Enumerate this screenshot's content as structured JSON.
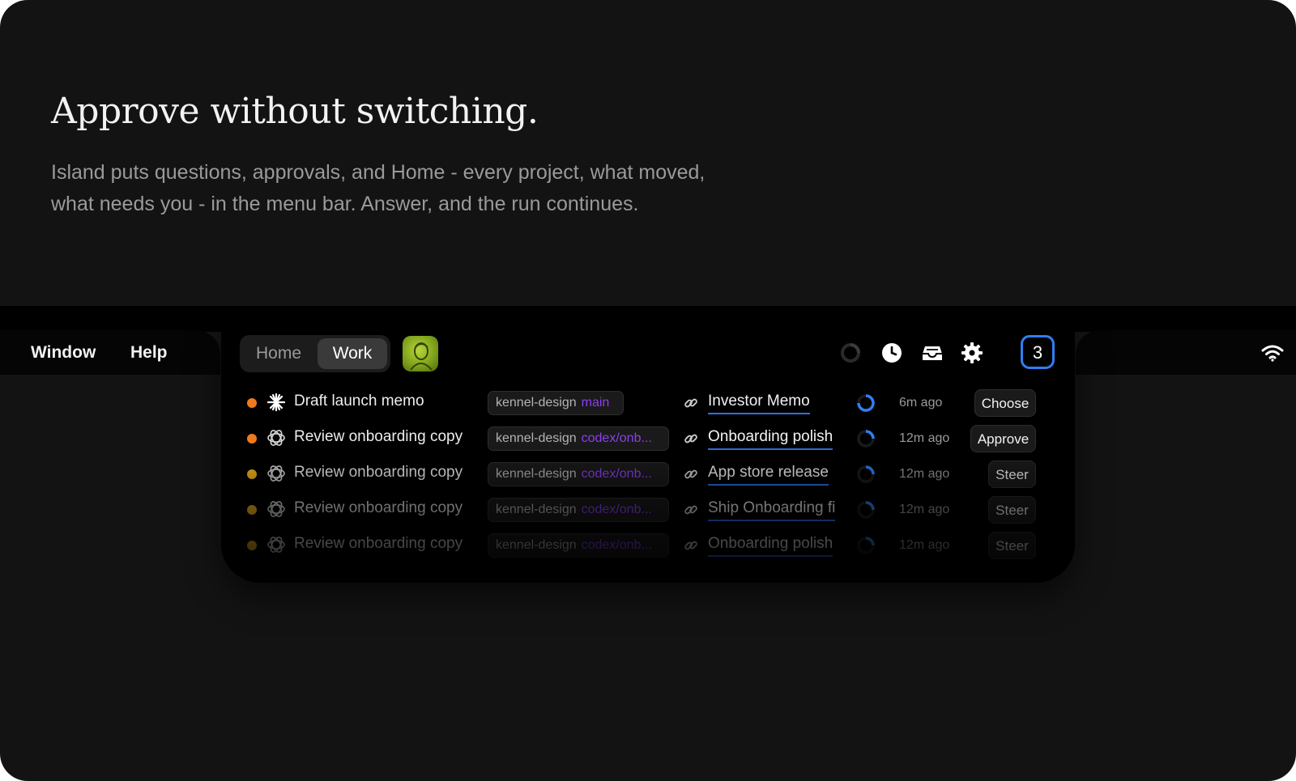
{
  "hero": {
    "title": "Approve without switching.",
    "body_line1": "Island puts questions, approvals, and Home - every project, what moved,",
    "body_line2": "what needs you - in the menu bar. Answer, and the run continues."
  },
  "menubar": {
    "items": [
      "Window",
      "Help"
    ]
  },
  "island": {
    "tabs": [
      {
        "label": "Home",
        "selected": false
      },
      {
        "label": "Work",
        "selected": true
      }
    ],
    "badge_count": "3",
    "accent": "#2f7ff0",
    "rows": [
      {
        "status_color": "#f07a1a",
        "agent_icon": "sparkle-icon",
        "task": "Draft launch memo",
        "repo": "kennel-design",
        "branch": "main",
        "link": "Investor Memo",
        "time": "6m ago",
        "action": "Choose"
      },
      {
        "status_color": "#f07a1a",
        "agent_icon": "openai-knot-icon",
        "task": "Review onboarding copy",
        "repo": "kennel-design",
        "branch": "codex/onb...",
        "link": "Onboarding polish",
        "time": "12m ago",
        "action": "Approve"
      },
      {
        "status_color": "#f4b41a",
        "agent_icon": "openai-knot-icon",
        "task": "Review onboarding copy",
        "repo": "kennel-design",
        "branch": "codex/onb...",
        "link": "App store release",
        "time": "12m ago",
        "action": "Steer"
      },
      {
        "status_color": "#f4b41a",
        "agent_icon": "openai-knot-icon",
        "task": "Review onboarding copy",
        "repo": "kennel-design",
        "branch": "codex/onb...",
        "link": "Ship Onboarding fi",
        "time": "12m ago",
        "action": "Steer"
      },
      {
        "status_color": "#f4b41a",
        "agent_icon": "openai-knot-icon",
        "task": "Review onboarding copy",
        "repo": "kennel-design",
        "branch": "codex/onb...",
        "link": "Onboarding polish",
        "time": "12m ago",
        "action": "Steer"
      }
    ]
  },
  "colors": {
    "branch": "#8b3ff0",
    "link_underline": "#2f6fe0",
    "status_orange": "#f07a1a",
    "status_yellow": "#f4b41a"
  }
}
